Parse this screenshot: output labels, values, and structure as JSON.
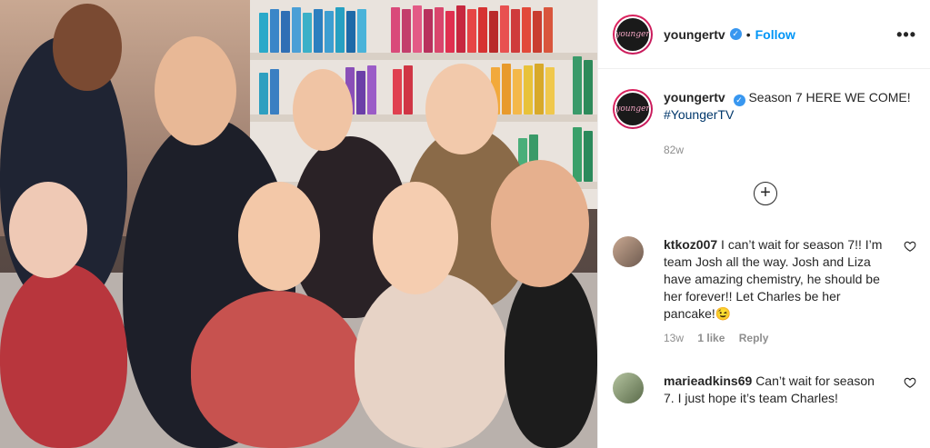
{
  "post": {
    "author": "youngertv",
    "avatar_text": "younger",
    "follow_label": "Follow",
    "separator": "•",
    "more_icon": "more-horizontal-icon",
    "caption_text": "Season 7 HERE WE COME!",
    "caption_hashtag": "#YoungerTV",
    "caption_time": "82w",
    "load_more_icon": "plus-circle-icon"
  },
  "comments": [
    {
      "username": "ktkoz007",
      "text": "I can’t wait for season 7!! I’m team Josh all the way. Josh and Liza have amazing chemistry, he should be her forever!! Let Charles be her pancake!😉",
      "time": "13w",
      "likes": "1 like",
      "reply": "Reply"
    },
    {
      "username": "marieadkins69",
      "text": "Can’t wait for season 7. I just hope it’s team Charles!",
      "time": "",
      "likes": "",
      "reply": ""
    }
  ],
  "colors": {
    "link_blue": "#0095f6",
    "hashtag_blue": "#00376b",
    "verified_blue": "#3897f0",
    "muted_gray": "#8e8e8e"
  }
}
